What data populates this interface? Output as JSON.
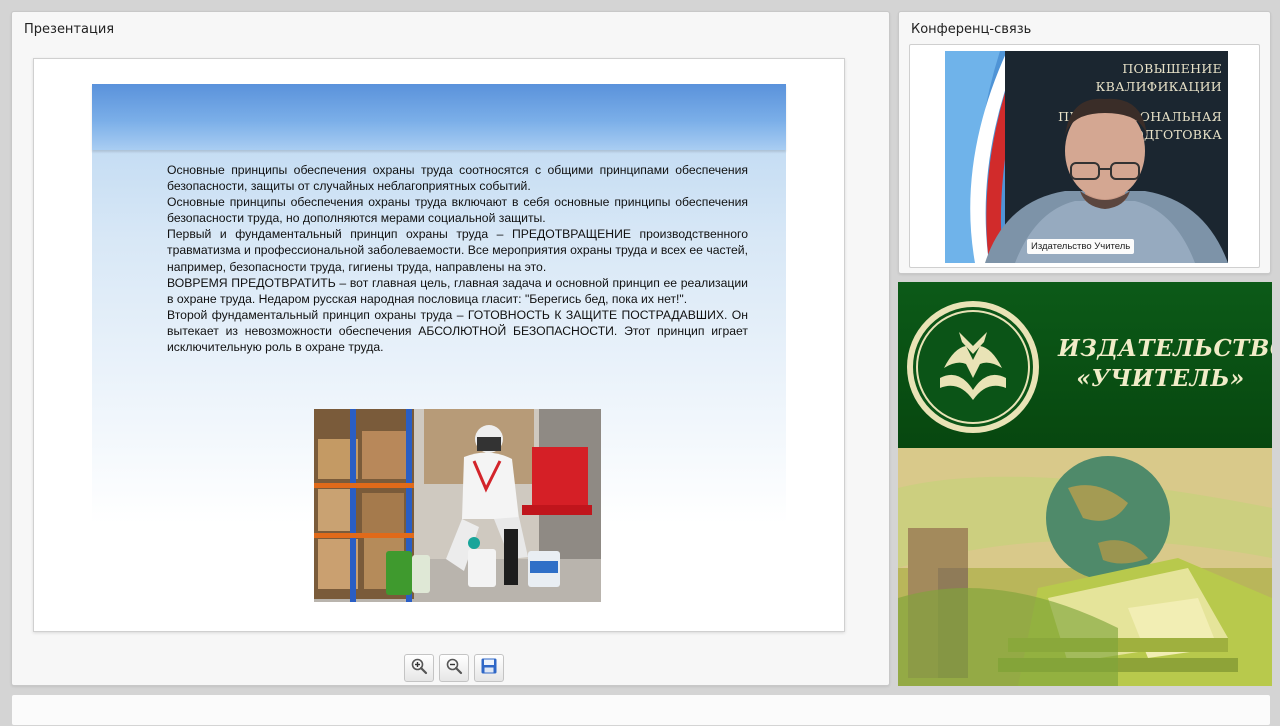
{
  "presentation": {
    "title": "Презентация",
    "slide": {
      "paragraphs": [
        "Основные принципы обеспечения охраны труда соотносятся с общими принципами обеспечения безопасности, защиты от случайных неблагоприятных событий.",
        "Основные принципы обеспечения охраны труда включают в себя основные принципы обеспечения безопасности труда, но дополняются мерами социальной защиты.",
        "Первый и фундаментальный принцип охраны труда – ПРЕДОТВРАЩЕНИЕ производственного травматизма и профессиональной заболеваемости. Все мероприятия охраны труда и всех ее частей, например, безопасности труда, гигиены труда, направлены на это.",
        "ВОВРЕМЯ ПРЕДОТВРАТИТЬ – вот главная цель, главная задача и основной принцип ее реализации в охране труда. Недаром русская народная пословица гласит: \"Берегись бед, пока их нет!\".",
        "Второй фундаментальный принцип охраны труда – ГОТОВНОСТЬ К ЗАЩИТЕ ПОСТРАДАВШИХ. Он вытекает из невозможности обеспечения АБСОЛЮТНОЙ БЕЗОПАСНОСТИ. Этот принцип играет исключительную роль в охране труда."
      ],
      "photo_icon": "worker-in-protective-suit-image"
    },
    "toolbar": {
      "zoom_in_icon": "zoom-in-icon",
      "zoom_out_icon": "zoom-out-icon",
      "save_icon": "save-icon"
    }
  },
  "conference": {
    "title": "Конференц-связь",
    "participant_label": "Издательство Учитель",
    "banner_lines": [
      "ПОВЫШЕНИЕ",
      "КВАЛИФИКАЦИИ",
      "ПРОФЕССИОНАЛЬНАЯ",
      "ПОДГОТОВКА"
    ]
  },
  "publisher": {
    "line1": "ИЗДАТЕЛЬСТВО",
    "line2": "«УЧИТЕЛЬ»",
    "logo_icon": "book-logo-icon"
  },
  "colors": {
    "publisher_green": "#0a5214",
    "slide_banner_blue": "#5a92db"
  }
}
